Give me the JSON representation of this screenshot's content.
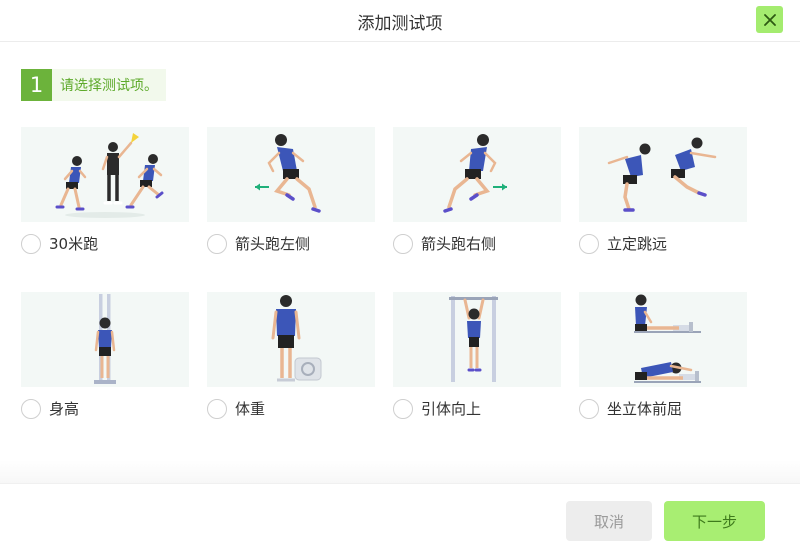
{
  "dialog": {
    "title": "添加测试项",
    "close_icon": "close-icon"
  },
  "step": {
    "number": "1",
    "instruction": "请选择测试项。"
  },
  "tests": [
    {
      "label": "30米跑",
      "icon": "sprint-30m-illustration"
    },
    {
      "label": "箭头跑左侧",
      "icon": "arrow-run-left-illustration"
    },
    {
      "label": "箭头跑右侧",
      "icon": "arrow-run-right-illustration"
    },
    {
      "label": "立定跳远",
      "icon": "standing-long-jump-illustration"
    },
    {
      "label": "身高",
      "icon": "height-illustration"
    },
    {
      "label": "体重",
      "icon": "weight-illustration"
    },
    {
      "label": "引体向上",
      "icon": "pull-up-illustration"
    },
    {
      "label": "坐立体前屈",
      "icon": "sit-and-reach-illustration"
    }
  ],
  "footer": {
    "cancel_label": "取消",
    "next_label": "下一步"
  },
  "colors": {
    "accent": "#6cb33b",
    "button_green": "#a8ee72",
    "card_bg": "#f3f8f6",
    "athlete_shirt": "#3c56b8"
  }
}
